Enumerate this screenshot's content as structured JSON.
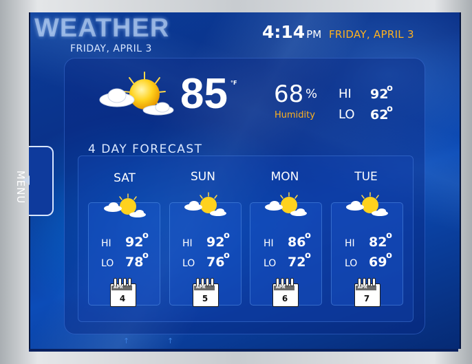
{
  "app": {
    "title": "WEATHER",
    "subtitle_date": "FRIDAY, APRIL 3"
  },
  "header": {
    "time": "4:14",
    "ampm": "PM",
    "date": "FRIDAY, APRIL 3"
  },
  "current": {
    "icon": "partly-cloudy-icon",
    "temperature": "85",
    "unit": "°F",
    "humidity_value": "68",
    "humidity_pct": "%",
    "humidity_label": "Humidity",
    "hi_label": "HI",
    "hi": "92",
    "lo_label": "LO",
    "lo": "62",
    "degree": "o"
  },
  "forecast": {
    "title": "4 DAY FORECAST",
    "days": [
      {
        "name": "SAT",
        "icon": "partly-cloudy-icon",
        "hi_label": "HI",
        "hi": "92",
        "lo_label": "LO",
        "lo": "78",
        "deg": "o",
        "cal_month": "APR",
        "cal_day": "4"
      },
      {
        "name": "SUN",
        "icon": "partly-cloudy-icon",
        "hi_label": "HI",
        "hi": "92",
        "lo_label": "LO",
        "lo": "76",
        "deg": "o",
        "cal_month": "APR",
        "cal_day": "5"
      },
      {
        "name": "MON",
        "icon": "partly-cloudy-icon",
        "hi_label": "HI",
        "hi": "86",
        "lo_label": "LO",
        "lo": "72",
        "deg": "o",
        "cal_month": "APR",
        "cal_day": "6"
      },
      {
        "name": "TUE",
        "icon": "partly-cloudy-icon",
        "hi_label": "HI",
        "hi": "82",
        "lo_label": "LO",
        "lo": "69",
        "deg": "o",
        "cal_month": "APR",
        "cal_day": "7"
      }
    ]
  },
  "menu": {
    "label": "MENU",
    "icon": "triangle-left-icon"
  },
  "colors": {
    "accent": "#ffb21e",
    "screen_bg": "#0a2f86",
    "text": "#ffffff"
  }
}
